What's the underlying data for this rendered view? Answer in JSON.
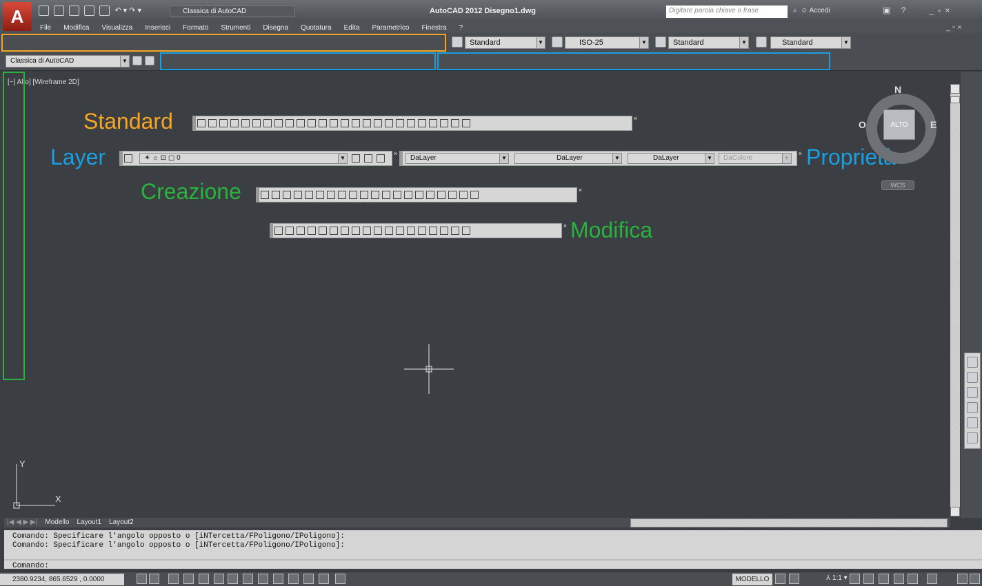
{
  "app": {
    "logo_letter": "A",
    "title": "AutoCAD 2012  Disegno1.dwg",
    "workspace": "Classica di AutoCAD",
    "search_placeholder": "Digitare parola chiave o frase",
    "login": "Accedi"
  },
  "menu": [
    "File",
    "Modifica",
    "Visualizza",
    "Inserisci",
    "Formato",
    "Strumenti",
    "Disegna",
    "Quotatura",
    "Edita",
    "Parametrico",
    "Finestra",
    "?"
  ],
  "styles_toolbar": {
    "text_style": "Standard",
    "dim_style": "ISO-25",
    "table_style": "Standard",
    "mleader_style": "Standard"
  },
  "workspace_toolbar": {
    "combo": "Classica di AutoCAD"
  },
  "viewport": {
    "label": "[−] Alto] [Wireframe 2D]"
  },
  "floating_toolbars": {
    "standard_label": "Standard",
    "layer_label": "Layer",
    "layer_value": "0",
    "properties_label": "Proprietà",
    "color": "DaLayer",
    "linetype": "DaLayer",
    "lineweight": "DaLayer",
    "plotstyle": "DaColore",
    "draw_label": "Creazione",
    "modify_label": "Modifica"
  },
  "viewcube": {
    "face": "ALTO",
    "north": "N",
    "west": "O",
    "east": "E",
    "ucs": "WCS"
  },
  "ucs_icon": {
    "x": "X",
    "y": "Y"
  },
  "tabs": [
    "Modello",
    "Layout1",
    "Layout2"
  ],
  "command": {
    "lines": [
      "Comando: Specificare l'angolo opposto o [iNTercetta/FPoligono/IPoligono]:",
      "Comando: Specificare l'angolo opposto o [iNTercetta/FPoligono/IPoligono]:"
    ],
    "prompt": "Comando:"
  },
  "status": {
    "coords": "2380.9234, 865.6529 , 0.0000",
    "space": "MODELLO",
    "scale": "1:1"
  },
  "colors": {
    "orange": "#f5a623",
    "blue": "#1aa0e0",
    "green": "#29b33c",
    "canvas": "#3b3e43"
  }
}
